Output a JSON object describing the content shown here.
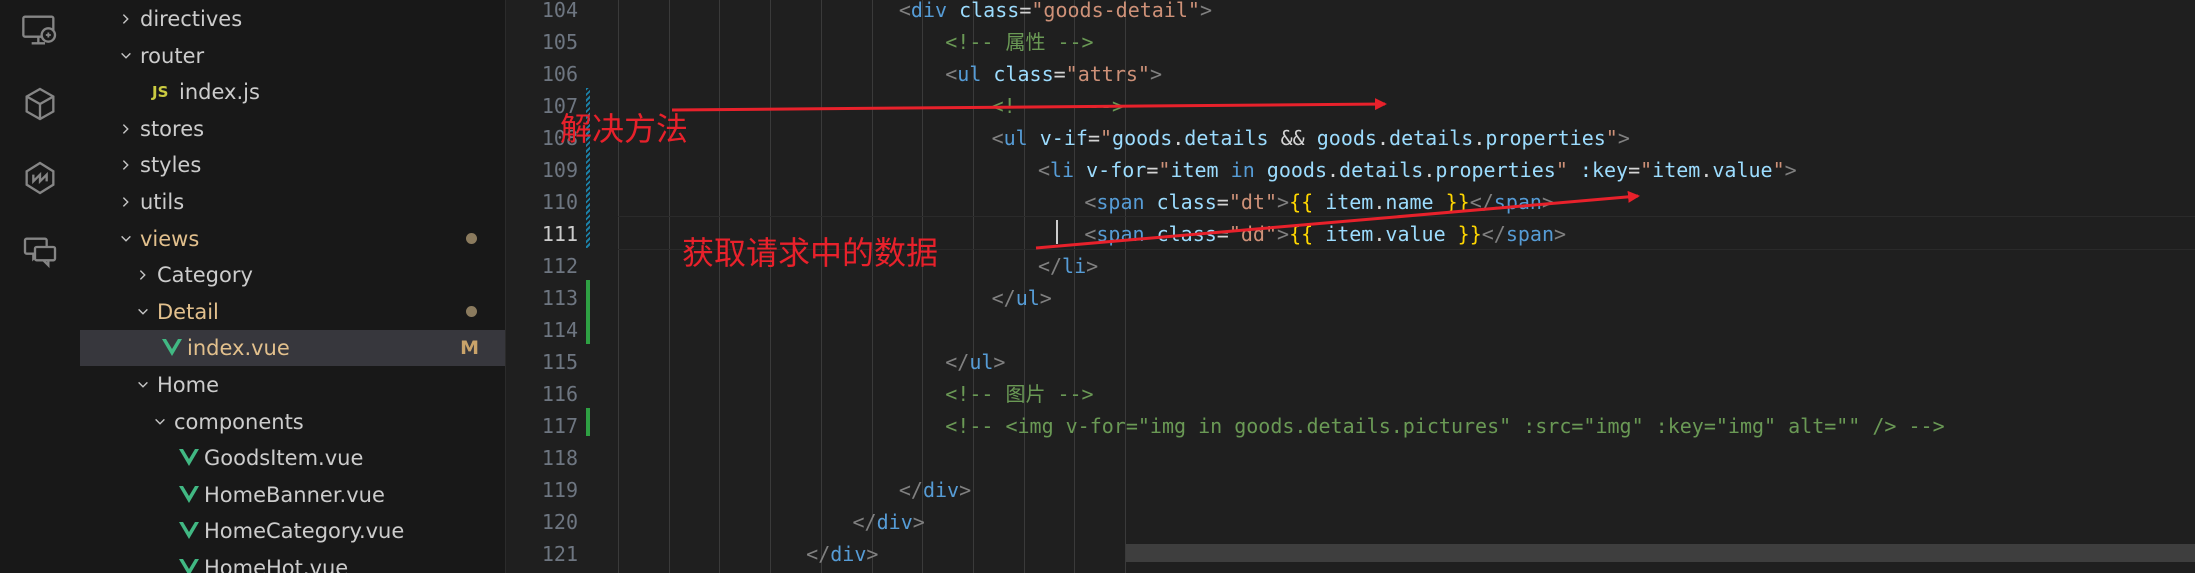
{
  "activity_bar": {
    "icons": [
      "remote-explorer-icon",
      "extensions-icon",
      "source-icon",
      "chat-icon"
    ]
  },
  "explorer": {
    "items": [
      {
        "label": "directives",
        "type": "folder",
        "expanded": false,
        "depth": 1
      },
      {
        "label": "router",
        "type": "folder",
        "expanded": true,
        "depth": 1
      },
      {
        "label": "index.js",
        "type": "js",
        "depth": 2,
        "icon_text": "JS"
      },
      {
        "label": "stores",
        "type": "folder",
        "expanded": false,
        "depth": 1
      },
      {
        "label": "styles",
        "type": "folder",
        "expanded": false,
        "depth": 1
      },
      {
        "label": "utils",
        "type": "folder",
        "expanded": false,
        "depth": 1
      },
      {
        "label": "views",
        "type": "folder",
        "expanded": true,
        "depth": 1,
        "modified": true
      },
      {
        "label": "Category",
        "type": "folder",
        "expanded": false,
        "depth": 2
      },
      {
        "label": "Detail",
        "type": "folder",
        "expanded": true,
        "depth": 2,
        "modified": true
      },
      {
        "label": "index.vue",
        "type": "vue",
        "depth": 3,
        "selected": true,
        "badge": "M"
      },
      {
        "label": "Home",
        "type": "folder",
        "expanded": true,
        "depth": 2
      },
      {
        "label": "components",
        "type": "folder",
        "expanded": true,
        "depth": 3
      },
      {
        "label": "GoodsItem.vue",
        "type": "vue",
        "depth": 4
      },
      {
        "label": "HomeBanner.vue",
        "type": "vue",
        "depth": 4
      },
      {
        "label": "HomeCategory.vue",
        "type": "vue",
        "depth": 4
      },
      {
        "label": "HomeHot.vue",
        "type": "vue",
        "depth": 4
      }
    ]
  },
  "editor": {
    "active_line": "111",
    "lines": [
      {
        "num": "104",
        "indent": 8,
        "tokens": [
          [
            "tg",
            "<"
          ],
          [
            "tn",
            "div "
          ],
          [
            "an",
            "class"
          ],
          [
            "ws",
            "="
          ],
          [
            "av",
            "\"goods-detail\""
          ],
          [
            "tg",
            ">"
          ]
        ]
      },
      {
        "num": "105",
        "indent": 9,
        "tokens": [
          [
            "cm",
            "<!-- 属性 -->"
          ]
        ]
      },
      {
        "num": "106",
        "indent": 9,
        "tokens": [
          [
            "tg",
            "<"
          ],
          [
            "tn",
            "ul "
          ],
          [
            "an",
            "class"
          ],
          [
            "ws",
            "="
          ],
          [
            "av",
            "\"attrs\""
          ],
          [
            "tg",
            ">"
          ]
        ]
      },
      {
        "num": "107",
        "indent": 10,
        "tokens": [
          [
            "cm",
            "<!--    -->"
          ]
        ]
      },
      {
        "num": "108",
        "indent": 10,
        "tokens": [
          [
            "tg",
            "<"
          ],
          [
            "tn",
            "ul "
          ],
          [
            "an",
            "v-if"
          ],
          [
            "ws",
            "="
          ],
          [
            "av",
            "\""
          ],
          [
            "tx",
            "goods"
          ],
          [
            "ws",
            "."
          ],
          [
            "tx",
            "details"
          ],
          [
            "ws",
            " && "
          ],
          [
            "tx",
            "goods"
          ],
          [
            "ws",
            "."
          ],
          [
            "tx",
            "details"
          ],
          [
            "ws",
            "."
          ],
          [
            "tx",
            "properties"
          ],
          [
            "av",
            "\""
          ],
          [
            "tg",
            ">"
          ]
        ]
      },
      {
        "num": "109",
        "indent": 11,
        "tokens": [
          [
            "tg",
            "<"
          ],
          [
            "tn",
            "li "
          ],
          [
            "an",
            "v-for"
          ],
          [
            "ws",
            "="
          ],
          [
            "av",
            "\""
          ],
          [
            "tx",
            "item"
          ],
          [
            "tn",
            " in "
          ],
          [
            "tx",
            "goods"
          ],
          [
            "ws",
            "."
          ],
          [
            "tx",
            "details"
          ],
          [
            "ws",
            "."
          ],
          [
            "tx",
            "properties"
          ],
          [
            "av",
            "\""
          ],
          [
            "ws",
            " "
          ],
          [
            "an",
            ":key"
          ],
          [
            "ws",
            "="
          ],
          [
            "av",
            "\""
          ],
          [
            "tx",
            "item"
          ],
          [
            "ws",
            "."
          ],
          [
            "tx",
            "value"
          ],
          [
            "av",
            "\""
          ],
          [
            "tg",
            ">"
          ]
        ]
      },
      {
        "num": "110",
        "indent": 12,
        "tokens": [
          [
            "tg",
            "<"
          ],
          [
            "tn",
            "span "
          ],
          [
            "an",
            "class"
          ],
          [
            "ws",
            "="
          ],
          [
            "av",
            "\"dt\""
          ],
          [
            "tg",
            ">"
          ],
          [
            "br",
            "{{ "
          ],
          [
            "tx",
            "item"
          ],
          [
            "ws",
            "."
          ],
          [
            "tx",
            "name"
          ],
          [
            "br",
            " }}"
          ],
          [
            "tg",
            "</"
          ],
          [
            "tn",
            "span"
          ],
          [
            "tg",
            ">"
          ]
        ]
      },
      {
        "num": "111",
        "indent": 12,
        "tokens": [
          [
            "tg",
            "<"
          ],
          [
            "tn",
            "span "
          ],
          [
            "an",
            "class"
          ],
          [
            "ws",
            "="
          ],
          [
            "av",
            "\"dd\""
          ],
          [
            "tg",
            ">"
          ],
          [
            "br",
            "{{ "
          ],
          [
            "tx",
            "item"
          ],
          [
            "ws",
            "."
          ],
          [
            "tx",
            "value"
          ],
          [
            "br",
            " }}"
          ],
          [
            "tg",
            "</"
          ],
          [
            "tn",
            "span"
          ],
          [
            "tg",
            ">"
          ]
        ]
      },
      {
        "num": "112",
        "indent": 11,
        "tokens": [
          [
            "tg",
            "</"
          ],
          [
            "tn",
            "li"
          ],
          [
            "tg",
            ">"
          ]
        ]
      },
      {
        "num": "113",
        "indent": 10,
        "tokens": [
          [
            "tg",
            "</"
          ],
          [
            "tn",
            "ul"
          ],
          [
            "tg",
            ">"
          ]
        ]
      },
      {
        "num": "114",
        "indent": 0,
        "tokens": []
      },
      {
        "num": "115",
        "indent": 9,
        "tokens": [
          [
            "tg",
            "</"
          ],
          [
            "tn",
            "ul"
          ],
          [
            "tg",
            ">"
          ]
        ]
      },
      {
        "num": "116",
        "indent": 9,
        "tokens": [
          [
            "cm",
            "<!-- 图片 -->"
          ]
        ]
      },
      {
        "num": "117",
        "indent": 9,
        "tokens": [
          [
            "cm",
            "<!-- <img v-for=\"img in goods.details.pictures\" :src=\"img\" :key=\"img\" alt=\"\" /> -->"
          ]
        ]
      },
      {
        "num": "118",
        "indent": 0,
        "tokens": []
      },
      {
        "num": "119",
        "indent": 8,
        "tokens": [
          [
            "tg",
            "</"
          ],
          [
            "tn",
            "div"
          ],
          [
            "tg",
            ">"
          ]
        ]
      },
      {
        "num": "120",
        "indent": 7,
        "tokens": [
          [
            "tg",
            "</"
          ],
          [
            "tn",
            "div"
          ],
          [
            "tg",
            ">"
          ]
        ]
      },
      {
        "num": "121",
        "indent": 6,
        "tokens": [
          [
            "tg",
            "</"
          ],
          [
            "tn",
            "div"
          ],
          [
            "tg",
            ">"
          ]
        ]
      }
    ]
  },
  "annotations": {
    "note1": "解决方法",
    "note2": "获取请求中的数据",
    "color": "#e8212b"
  },
  "colors": {
    "vue": "#41b883",
    "js": "#cbcb41",
    "modified_folder": "#e2c08d",
    "git_added": "#2ea043",
    "git_modified": "#1b81a8"
  }
}
